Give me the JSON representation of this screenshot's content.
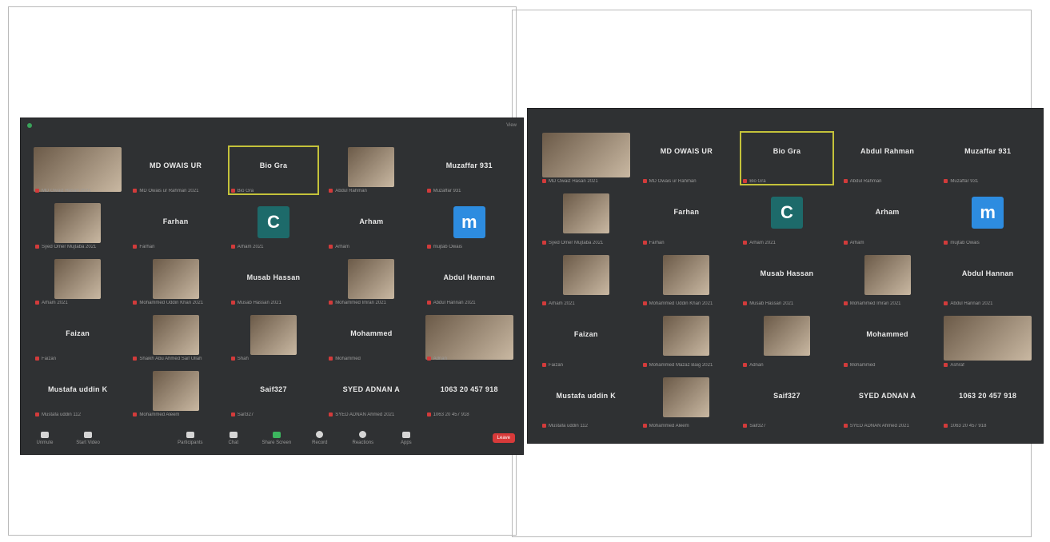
{
  "colors": {
    "background": "#2f3133",
    "active_border": "#c4c23a",
    "avatar_c": "#1d6a6a",
    "avatar_m": "#2d8ce0",
    "end_button": "#d83a3a",
    "mic_muted": "#d23b3b"
  },
  "left": {
    "tiles": [
      {
        "name": "",
        "sub": "MD Owaiz Hasan 2021",
        "video": "v1",
        "wide": true
      },
      {
        "name": "MD OWAIS UR",
        "sub": "MD Owais ur Rahman 2021"
      },
      {
        "name": "Bio Gra",
        "sub": "Bio Gra",
        "active": true
      },
      {
        "name": "",
        "sub": "Abdul Rahman",
        "video": "v2"
      },
      {
        "name": "Muzaffar 931",
        "sub": "Muzaffar 931"
      },
      {
        "name": "",
        "sub": "Syed Omer Mujtaba 2021",
        "video": "v6"
      },
      {
        "name": "Farhan",
        "sub": "Farhan"
      },
      {
        "name": "",
        "sub": "Arham 2021",
        "avatar": "C",
        "avatar_color": "#1d6a6a"
      },
      {
        "name": "Arham",
        "sub": "Arham"
      },
      {
        "name": "",
        "sub": "mujtab Owais",
        "avatar": "m",
        "avatar_color": "#2d8ce0"
      },
      {
        "name": "",
        "sub": "Arham 2021",
        "video": "v3"
      },
      {
        "name": "",
        "sub": "Mohammed Uddin Khan 2021",
        "video": "v4"
      },
      {
        "name": "Musab Hassan",
        "sub": "Musab Hassan 2021"
      },
      {
        "name": "",
        "sub": "Mohammed Imran 2021",
        "video": "v5"
      },
      {
        "name": "Abdul Hannan",
        "sub": "Abdul Hannan 2021"
      },
      {
        "name": "Faizan",
        "sub": "Faizan"
      },
      {
        "name": "",
        "sub": "Shaikh Abu Ahmed Saif Ullah",
        "video": "v8"
      },
      {
        "name": "",
        "sub": "Shah",
        "video": "v7"
      },
      {
        "name": "Mohammed",
        "sub": "Mohammed"
      },
      {
        "name": "",
        "sub": "Adnan",
        "video": "v8",
        "wide": true
      },
      {
        "name": "Mustafa uddin K",
        "sub": "Mustafa uddin 112"
      },
      {
        "name": "",
        "sub": "Mohammed Aleem",
        "video": "v9"
      },
      {
        "name": "Saif327",
        "sub": "Saif327"
      },
      {
        "name": "SYED ADNAN A",
        "sub": "SYED ADNAN Ahmed 2021"
      },
      {
        "name": "1063 20 457 918",
        "sub": "1063 20 457 918"
      }
    ],
    "toolbar": {
      "mute": "Unmute",
      "video": "Start Video",
      "participants": "Participants",
      "chat": "Chat",
      "share": "Share Screen",
      "record": "Record",
      "reactions": "Reactions",
      "apps": "Apps",
      "end": "Leave",
      "view": "View"
    }
  },
  "right": {
    "tiles": [
      {
        "name": "",
        "sub": "MD Owaiz Hasan 2021",
        "video": "v1",
        "wide": true
      },
      {
        "name": "MD OWAIS UR",
        "sub": "MD Owais ur Rahman"
      },
      {
        "name": "Bio Gra",
        "sub": "Bio Gra",
        "active": true
      },
      {
        "name": "Abdul Rahman",
        "sub": "Abdul Rahman"
      },
      {
        "name": "Muzaffar 931",
        "sub": "Muzaffar 931"
      },
      {
        "name": "",
        "sub": "Syed Omer Mujtaba 2021",
        "video": "v3"
      },
      {
        "name": "Farhan",
        "sub": "Farhan"
      },
      {
        "name": "",
        "sub": "Arham 2021",
        "avatar": "C",
        "avatar_color": "#1d6a6a"
      },
      {
        "name": "Arham",
        "sub": "Arham"
      },
      {
        "name": "",
        "sub": "mujtab Owais",
        "avatar": "m",
        "avatar_color": "#2d8ce0"
      },
      {
        "name": "",
        "sub": "Arham 2021",
        "video": "v3"
      },
      {
        "name": "",
        "sub": "Mohammed Uddin Khan 2021",
        "video": "v4"
      },
      {
        "name": "Musab Hassan",
        "sub": "Musab Hassan 2021"
      },
      {
        "name": "",
        "sub": "Mohammed Imran 2021",
        "video": "v5"
      },
      {
        "name": "Abdul Hannan",
        "sub": "Abdul Hannan 2021"
      },
      {
        "name": "Faizan",
        "sub": "Faizan"
      },
      {
        "name": "",
        "sub": "Mohammed Mazaz Baig 2021",
        "video": "v8"
      },
      {
        "name": "",
        "sub": "Adnan",
        "video": "v7"
      },
      {
        "name": "Mohammed",
        "sub": "Mohammed"
      },
      {
        "name": "",
        "sub": "Ashraf",
        "video": "v8",
        "wide": true
      },
      {
        "name": "Mustafa uddin K",
        "sub": "Mustafa uddin 112"
      },
      {
        "name": "",
        "sub": "Mohammed Aleem",
        "video": "v9"
      },
      {
        "name": "Saif327",
        "sub": "Saif327"
      },
      {
        "name": "SYED ADNAN A",
        "sub": "SYED ADNAN Ahmed 2021"
      },
      {
        "name": "1063 20 457 918",
        "sub": "1063 20 457 918"
      }
    ]
  }
}
